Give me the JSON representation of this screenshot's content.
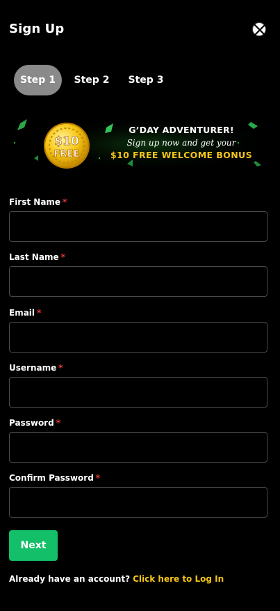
{
  "header": {
    "title": "Sign Up",
    "close_icon": "close-icon"
  },
  "steps": [
    {
      "label": "Step 1",
      "active": true
    },
    {
      "label": "Step 2",
      "active": false
    },
    {
      "label": "Step 3",
      "active": false
    }
  ],
  "banner": {
    "coin_line1": "$10",
    "coin_line2": "FREE",
    "headline": "G’DAY ADVENTURER!",
    "subline": "Sign up now and get your",
    "bonus": "$10 FREE WELCOME BONUS"
  },
  "form": {
    "fields": [
      {
        "label": "First Name",
        "required_mark": "*",
        "value": "",
        "placeholder": ""
      },
      {
        "label": "Last Name",
        "required_mark": "*",
        "value": "",
        "placeholder": ""
      },
      {
        "label": "Email",
        "required_mark": "*",
        "value": "",
        "placeholder": ""
      },
      {
        "label": "Username",
        "required_mark": "*",
        "value": "",
        "placeholder": ""
      },
      {
        "label": "Password",
        "required_mark": "*",
        "value": "",
        "placeholder": ""
      },
      {
        "label": "Confirm Password",
        "required_mark": "*",
        "value": "",
        "placeholder": ""
      }
    ],
    "next_label": "Next"
  },
  "footer": {
    "prompt": "Already have an account?",
    "link": "Click here to Log In"
  },
  "colors": {
    "background": "#000000",
    "active_step": "#8a8a8a",
    "primary_button": "#13bf68",
    "link": "#f5c518",
    "required": "#e53935",
    "input_border": "#4a4a4a"
  }
}
